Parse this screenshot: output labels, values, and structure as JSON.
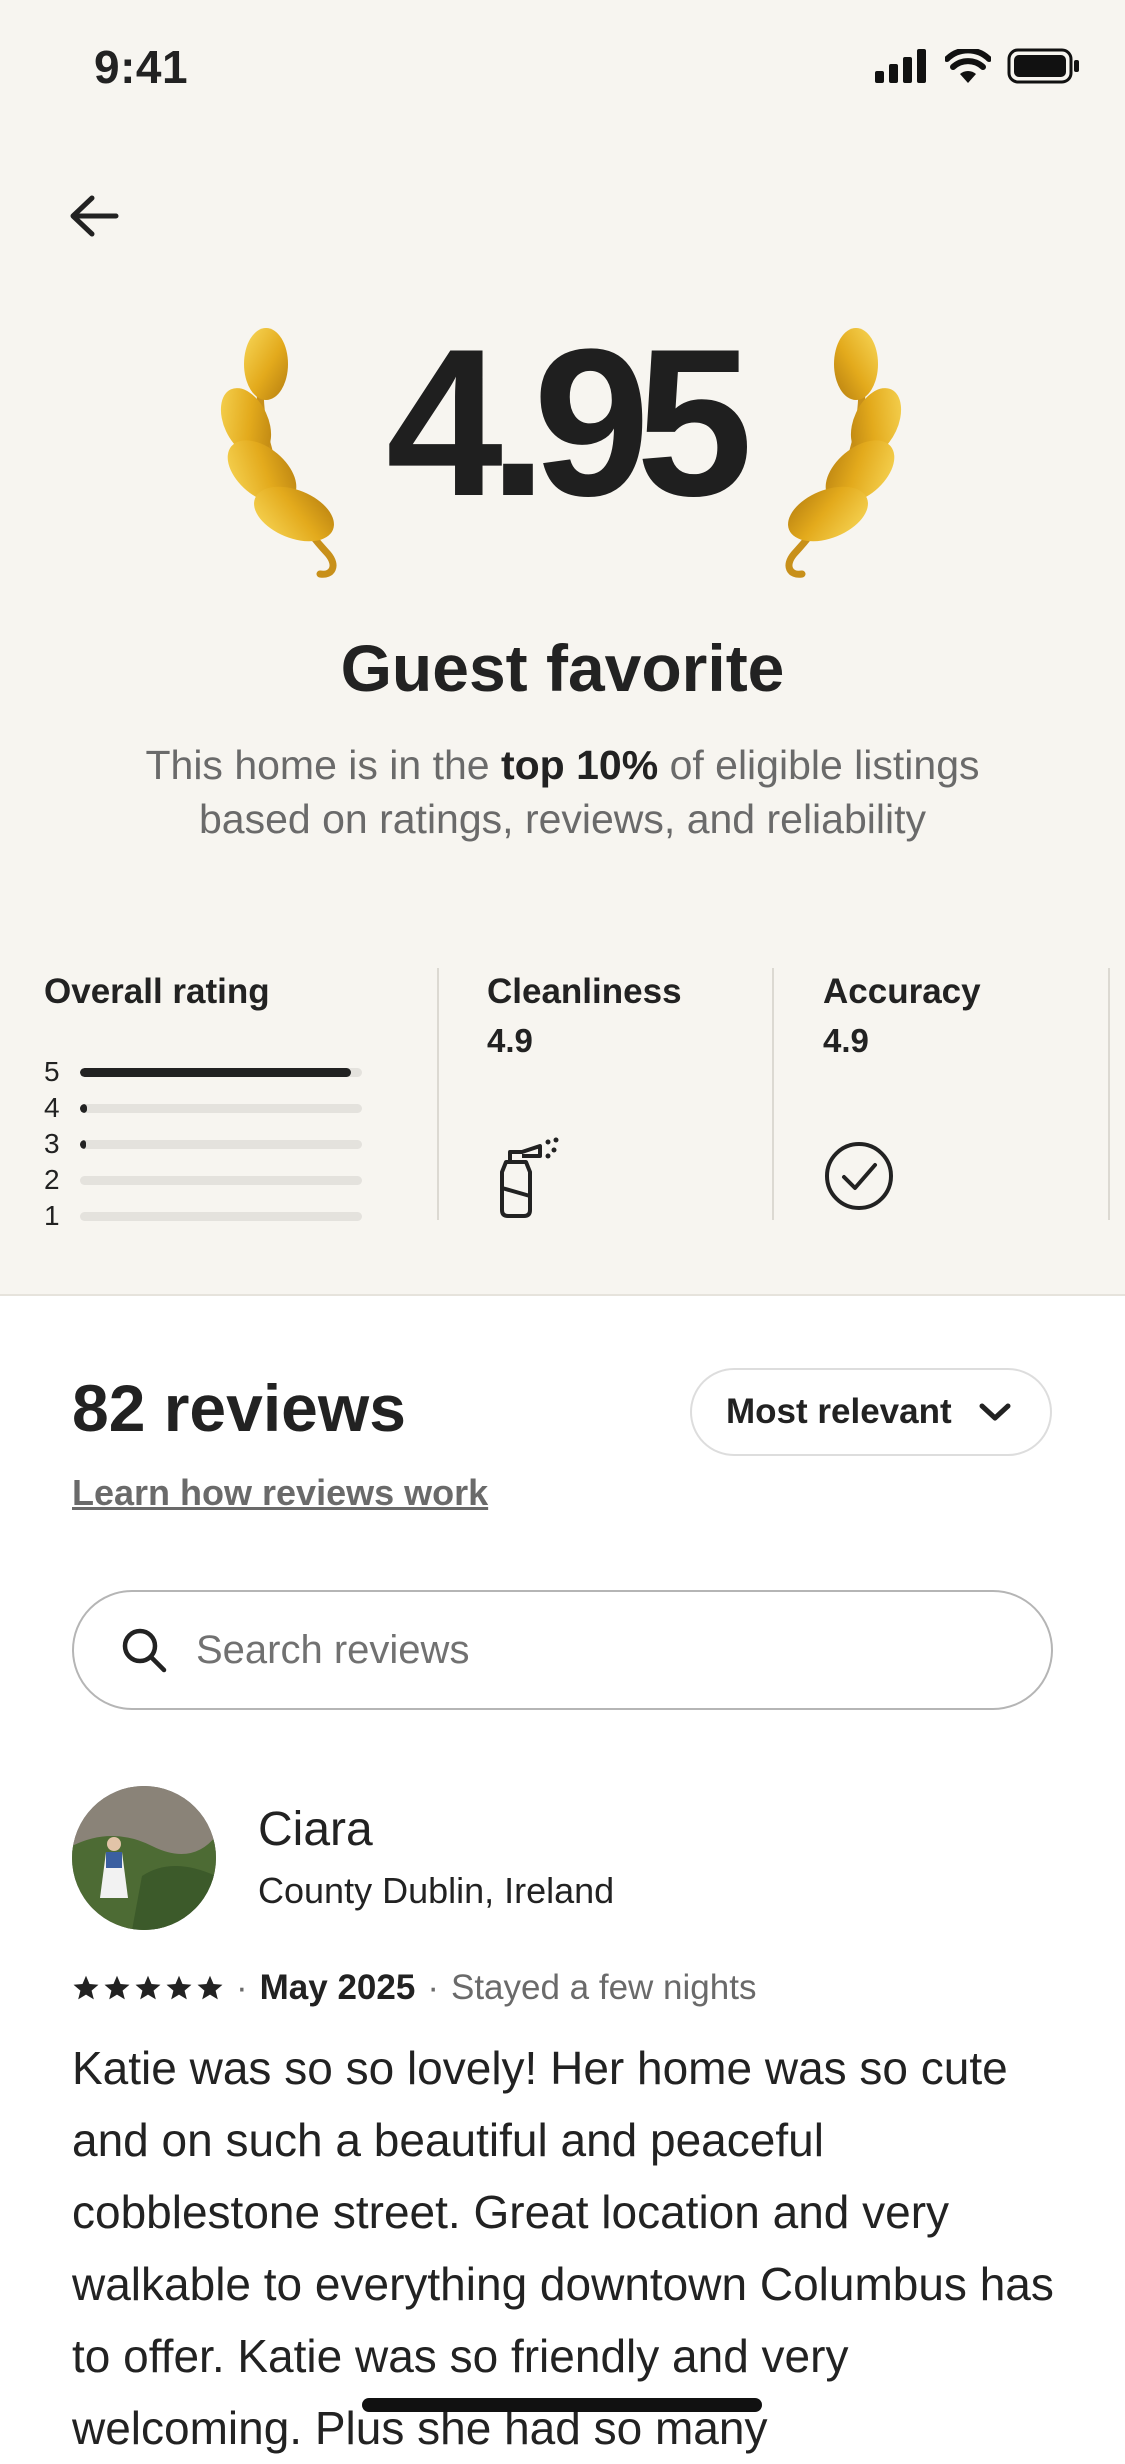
{
  "status_bar": {
    "time": "9:41"
  },
  "header": {
    "back_icon": "arrow-left-icon"
  },
  "hero": {
    "rating": "4.95",
    "title": "Guest favorite",
    "desc_pre": "This home is in the ",
    "desc_bold": "top 10%",
    "desc_post": " of eligible listings based on ratings, reviews, and reliability",
    "laurel_color": "#e8b828"
  },
  "categories": {
    "overall": {
      "label": "Overall rating",
      "bars": [
        {
          "label": "5",
          "fraction": 0.96
        },
        {
          "label": "4",
          "fraction": 0.025
        },
        {
          "label": "3",
          "fraction": 0.012
        },
        {
          "label": "2",
          "fraction": 0
        },
        {
          "label": "1",
          "fraction": 0
        }
      ]
    },
    "cleanliness": {
      "label": "Cleanliness",
      "value": "4.9",
      "icon": "spray-bottle-icon"
    },
    "accuracy": {
      "label": "Accuracy",
      "value": "4.9",
      "icon": "check-circle-icon"
    }
  },
  "reviews": {
    "count_label": "82 reviews",
    "learn_link": "Learn how reviews work",
    "sort_label": "Most relevant",
    "search_placeholder": "Search reviews",
    "items": [
      {
        "name": "Ciara",
        "location": "County Dublin, Ireland",
        "stars": 5,
        "date": "May 2025",
        "stay": "Stayed a few nights",
        "text": "Katie was so so lovely! Her home was so cute and on such a beautiful and peaceful cobblestone street. Great location and very walkable to everything downtown Columbus has to offer. Katie was so friendly and very welcoming. Plus she had so many"
      }
    ]
  },
  "colors": {
    "hero_bg": "#f7f5f0",
    "text": "#222222",
    "muted": "#6a6a6a"
  }
}
